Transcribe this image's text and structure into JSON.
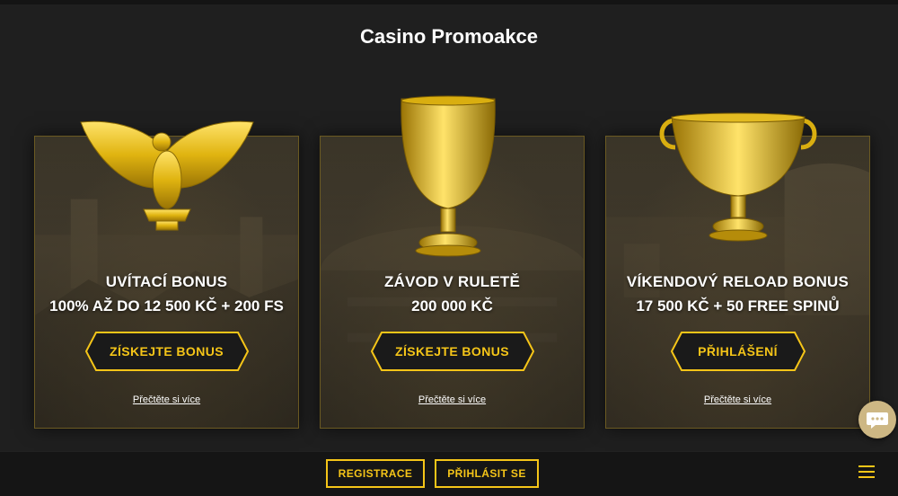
{
  "page": {
    "title": "Casino Promoakce"
  },
  "cards": [
    {
      "title": "UVÍTACÍ BONUS",
      "amount": "100% AŽ DO 12 500 KČ + 200 FS",
      "button_label": "ZÍSKEJTE BONUS",
      "read_more": "Přečtěte si více",
      "icon": "golden-eagle-icon"
    },
    {
      "title": "ZÁVOD V RULETĚ",
      "amount": "200 000 KČ",
      "button_label": "ZÍSKEJTE BONUS",
      "read_more": "Přečtěte si více",
      "icon": "golden-goblet-icon"
    },
    {
      "title": "VÍKENDOVÝ RELOAD BONUS",
      "amount": "17 500 KČ + 50 FREE SPINŮ",
      "button_label": "PŘIHLÁŠENÍ",
      "read_more": "Přečtěte si více",
      "icon": "golden-chalice-icon"
    }
  ],
  "footer": {
    "register_label": "REGISTRACE",
    "login_label": "PŘIHLÁSIT SE"
  },
  "icons": {
    "menu": "hamburger-menu-icon",
    "chat": "chat-bubble-icon"
  },
  "colors": {
    "accent": "#f5c518",
    "background": "#1f1f1f",
    "footer_bg": "#151515",
    "chat_bg": "#cdb784"
  }
}
